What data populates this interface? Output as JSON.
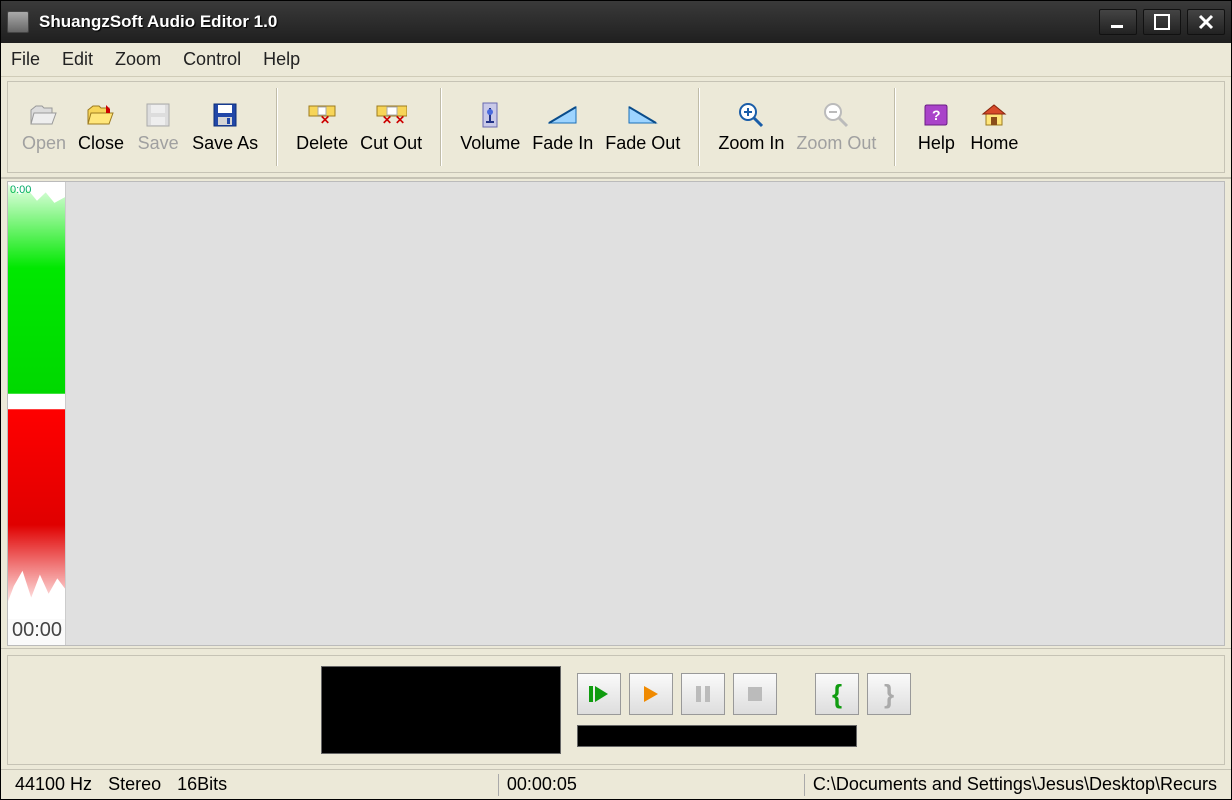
{
  "titlebar": {
    "title": "ShuangzSoft Audio Editor 1.0"
  },
  "menubar": {
    "items": [
      "File",
      "Edit",
      "Zoom",
      "Control",
      "Help"
    ]
  },
  "toolbar": {
    "open": "Open",
    "close": "Close",
    "save": "Save",
    "saveas": "Save As",
    "delete": "Delete",
    "cutout": "Cut Out",
    "volume": "Volume",
    "fadein": "Fade In",
    "fadeout": "Fade Out",
    "zoomin": "Zoom In",
    "zoomout": "Zoom Out",
    "help": "Help",
    "home": "Home"
  },
  "waveform": {
    "top_label": "0:00",
    "time": "00:00"
  },
  "statusbar": {
    "samplerate": "44100 Hz",
    "channels": "Stereo",
    "bits": "16Bits",
    "position": "00:00:05",
    "path": "C:\\Documents and Settings\\Jesus\\Desktop\\Recurs"
  }
}
